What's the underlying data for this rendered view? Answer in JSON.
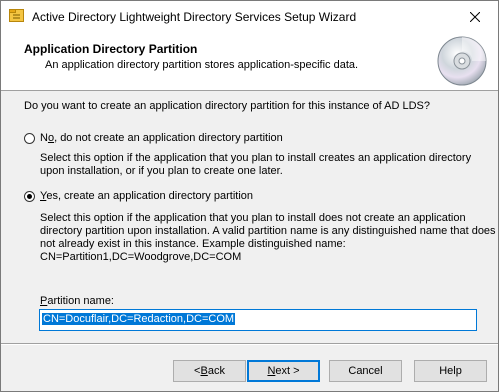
{
  "window": {
    "title": "Active Directory Lightweight Directory Services Setup Wizard",
    "icons": {
      "app": "folder-tree-icon",
      "close": "close-icon"
    }
  },
  "header": {
    "title": "Application Directory Partition",
    "subtitle": "An application directory partition stores application-specific data.",
    "icon": "cd-disc-icon"
  },
  "question": "Do you want to create an application directory partition for this instance of AD LDS?",
  "options": [
    {
      "label_pre": "N",
      "label_mnemonic": "o",
      "label_post": ", do not create an application directory partition",
      "selected": false,
      "description": [
        "Select this option if the application that you plan to install creates an application directory",
        "upon installation, or if you plan to create one later."
      ]
    },
    {
      "label_pre": "",
      "label_mnemonic": "Y",
      "label_post": "es, create an application directory partition",
      "selected": true,
      "description": [
        "Select this option if the application that you plan to install does not create an application",
        "directory partition upon installation. A valid partition name is any distinguished name that does",
        "not already exist in this instance. Example distinguished name:",
        "CN=Partition1,DC=Woodgrove,DC=COM"
      ]
    }
  ],
  "partition": {
    "label_mnemonic": "P",
    "label_rest": "artition name:",
    "value": "CN=Docuflair,DC=Redaction,DC=COM"
  },
  "buttons": {
    "back_prefix": "< ",
    "back_mnemonic": "B",
    "back_rest": "ack",
    "next_mnemonic": "N",
    "next_rest": "ext >",
    "cancel": "Cancel",
    "help": "Help"
  },
  "colors": {
    "accent": "#0078d7",
    "button_face": "#e1e1e1",
    "dialog_bg": "#f0f0f0"
  }
}
